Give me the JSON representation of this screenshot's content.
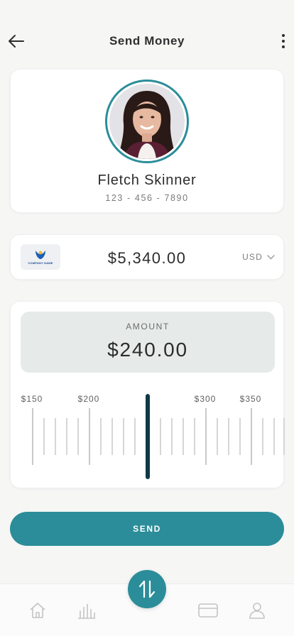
{
  "header": {
    "title": "Send Money"
  },
  "recipient": {
    "name": "Fletch Skinner",
    "phone": "123 - 456 - 7890"
  },
  "balance": {
    "amount": "$5,340.00",
    "currency": "USD",
    "logo_text": "COMPANY NAME"
  },
  "amount": {
    "label": "AMOUNT",
    "value": "$240.00",
    "ticks": [
      "$150",
      "$200",
      "$300",
      "$350"
    ]
  },
  "send_label": "SEND",
  "colors": {
    "accent": "#2b8d99",
    "indicator": "#0f3a46",
    "amount_bg": "#e6ebea"
  },
  "icons": {
    "header_left": "arrow-left-icon",
    "header_right": "more-vertical-icon",
    "currency": "chevron-down-icon",
    "nav": [
      "home-icon",
      "bar-chart-icon",
      "swap-icon",
      "card-icon",
      "user-icon"
    ]
  }
}
